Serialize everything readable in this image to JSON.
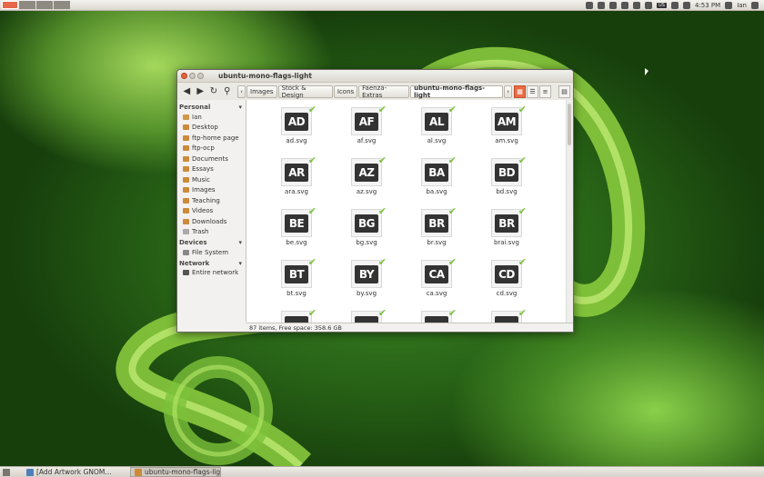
{
  "top_panel": {
    "time": "4:53 PM",
    "user": "Ian",
    "keyboard": "US"
  },
  "window": {
    "title": "ubuntu-mono-flags-light",
    "breadcrumbs": [
      "Images",
      "Stock & Design",
      "Icons",
      "Faenza-Extras",
      "ubuntu-mono-flags-light"
    ],
    "status": "87 items, Free space: 358.6 GB"
  },
  "sidebar": {
    "personal": {
      "label": "Personal",
      "items": [
        "Ian",
        "Desktop",
        "ftp-home page",
        "ftp-ocp",
        "Documents",
        "Essays",
        "Music",
        "Images",
        "Teaching",
        "Videos",
        "Downloads",
        "Trash"
      ]
    },
    "devices": {
      "label": "Devices",
      "items": [
        "File System"
      ]
    },
    "network": {
      "label": "Network",
      "items": [
        "Entire network"
      ]
    }
  },
  "files": [
    {
      "code": "AD",
      "name": "ad.svg"
    },
    {
      "code": "AF",
      "name": "af.svg"
    },
    {
      "code": "AL",
      "name": "al.svg"
    },
    {
      "code": "AM",
      "name": "am.svg"
    },
    {
      "code": "AR",
      "name": "ara.svg"
    },
    {
      "code": "AZ",
      "name": "az.svg"
    },
    {
      "code": "BA",
      "name": "ba.svg"
    },
    {
      "code": "BD",
      "name": "bd.svg"
    },
    {
      "code": "BE",
      "name": "be.svg"
    },
    {
      "code": "BG",
      "name": "bg.svg"
    },
    {
      "code": "BR",
      "name": "br.svg"
    },
    {
      "code": "BR",
      "name": "brai.svg"
    },
    {
      "code": "BT",
      "name": "bt.svg"
    },
    {
      "code": "BY",
      "name": "by.svg"
    },
    {
      "code": "CA",
      "name": "ca.svg"
    },
    {
      "code": "CD",
      "name": "cd.svg"
    }
  ],
  "taskbar": {
    "tasks": [
      "[Add Artwork GNOM...",
      "ubuntu-mono-flags-light"
    ]
  },
  "colors": {
    "accent": "#e96c44",
    "check": "#7cc243"
  }
}
